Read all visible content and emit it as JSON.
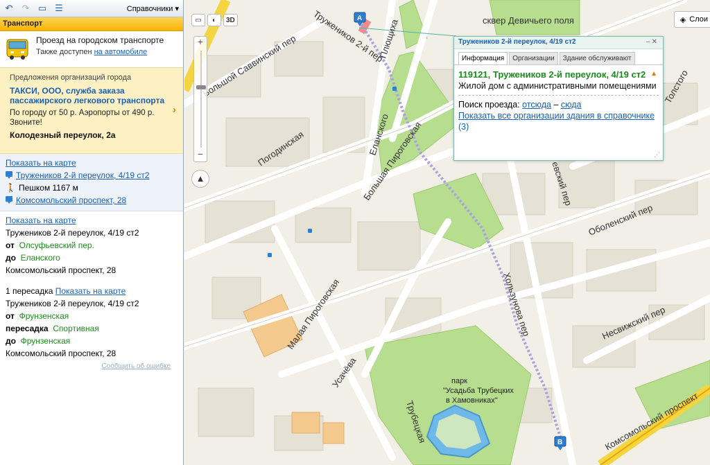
{
  "toolbar": {
    "back_icon": "back-arrow-icon",
    "forward_icon": "forward-arrow-icon",
    "reference_menu": "Справочники"
  },
  "section": {
    "title": "Транспорт"
  },
  "mode": {
    "text": "Проезд на городском транспорте",
    "also_prefix": "Также доступен ",
    "also_link": "на автомобиле"
  },
  "ad": {
    "caption": "Предложения организаций города",
    "title": "ТАКСИ, ООО, служба заказа пассажирского легкового транспорта",
    "description": "По городу от 50 р. Аэропорты от 490 р. Звоните!",
    "address": "Колодезный переулок, 2а"
  },
  "route1": {
    "show_map": "Показать на карте",
    "from": "Тружеников 2-й переулок, 4/19 ст2",
    "walk": "Пешком 1167 м",
    "to": "Комсомольский проспект, 28"
  },
  "route2": {
    "show_map": "Показать на карте",
    "start": "Тружеников 2-й переулок, 4/19 ст2",
    "from_label": "от",
    "from_stop": "Олсуфьевский пер.",
    "to_label": "до",
    "to_stop": "Еланского",
    "end": "Комсомольский проспект, 28"
  },
  "route3": {
    "transfers": "1 пересадка",
    "show_map": "Показать на карте",
    "start": "Тружеников 2-й переулок, 4/19 ст2",
    "from_label": "от",
    "from_stop": "Фрунзенская",
    "transfer_label": "пересадка",
    "transfer_stop": "Спортивная",
    "to_label": "до",
    "to_stop": "Фрунзенская",
    "end": "Комсомольский проспект, 28"
  },
  "report_error": "Сообщить об ошибке",
  "map": {
    "tool_3d": "3D",
    "layers": "Слои",
    "streets": {
      "truzhenikov": "Тружеников 2-й пер",
      "plyushikha": "Плющиха",
      "savvinsky": "Большой Саввинский пер",
      "pogodinskaya": "Погодинская",
      "elanskogo": "Еланского",
      "b_pirogovskaya": "Большая Пироговская",
      "obolensky": "Оболенский пер",
      "khoлzunova": "Хользунова пер",
      "nesvizhsky": "Несвижский пер",
      "m_pirogovskaya": "Малая Пироговская",
      "usacheva": "Усачёва",
      "trubetskaya": "Трубецкая",
      "komsomolsky": "Комсомольский проспект",
      "devichye": "сквер Девичьего поля",
      "tolstogo": "Толстого",
      "sevsky": "евский пер"
    },
    "park": {
      "line1": "парк",
      "line2": "\"Усадьба Трубецких",
      "line3": "в Хамовниках\""
    },
    "marker_a": "A",
    "marker_b": "B"
  },
  "popup": {
    "header": "Тружеников 2-й переулок, 4/19 ст2",
    "tabs": [
      "Информация",
      "Организации",
      "Здание обслуживают"
    ],
    "title": "119121, Тружеников 2-й переулок, 4/19 ст2",
    "description": "Жилой дом с административными помещениями",
    "search_prefix": "Поиск проезда: ",
    "search_from": "отсюда",
    "search_dash": " – ",
    "search_to": "сюда",
    "show_all": "Показать все организации здания в справочнике",
    "count": " (3)"
  }
}
